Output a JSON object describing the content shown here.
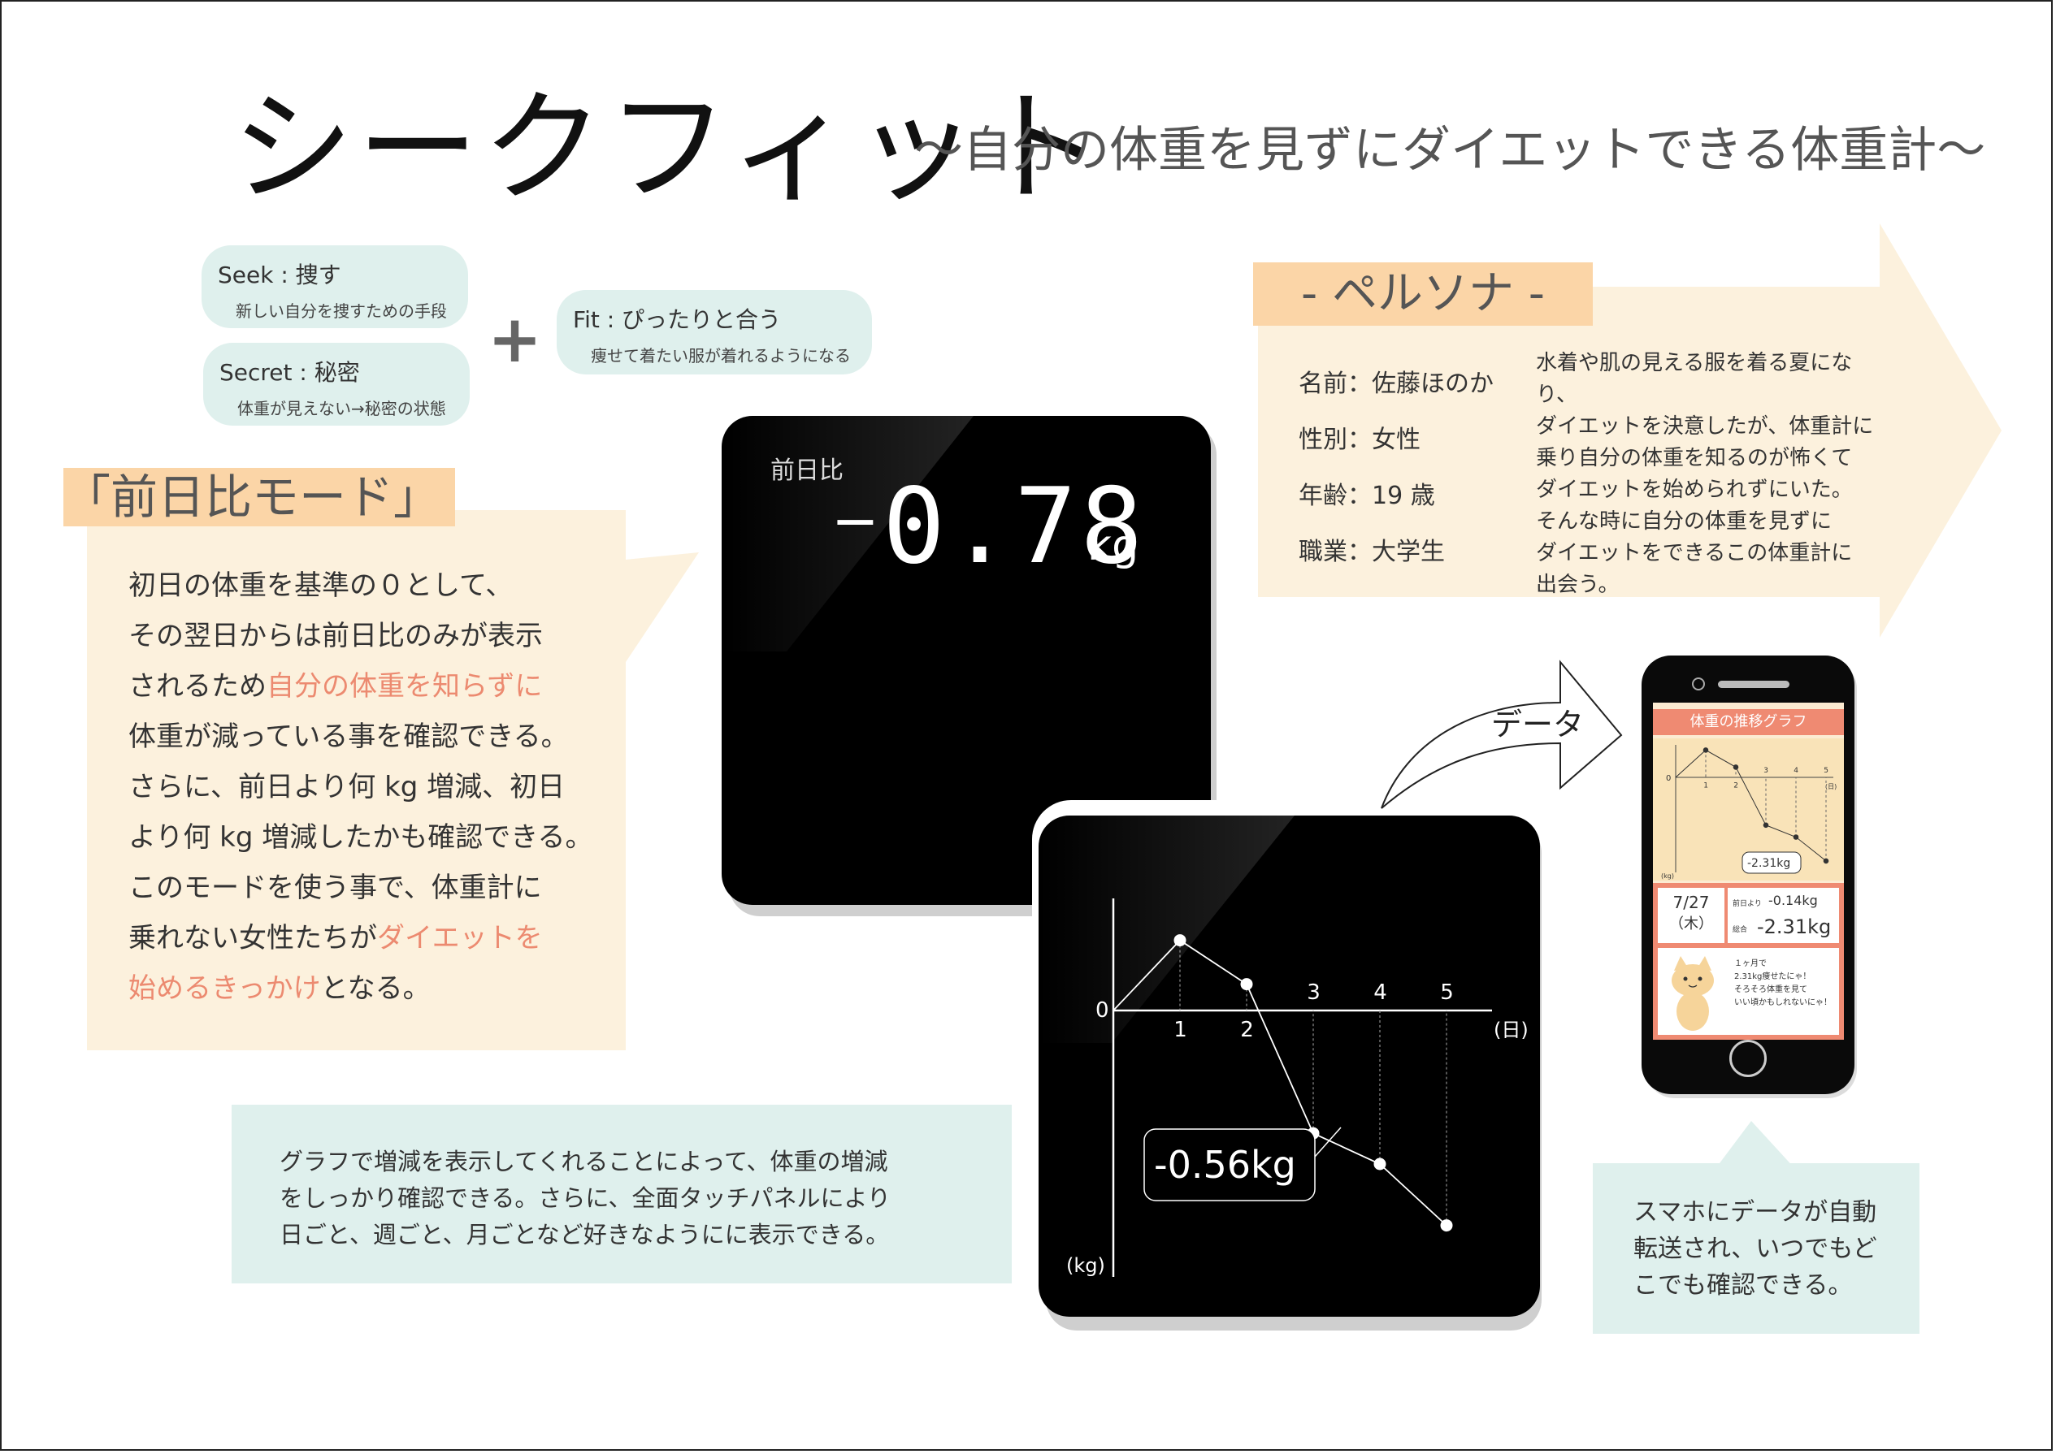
{
  "title": "シークフィット",
  "subtitle": "〜自分の体重を見ずにダイエットできる体重計〜",
  "concept": {
    "seek": {
      "head": "Seek : 捜す",
      "sub": "新しい自分を捜すための手段"
    },
    "secret": {
      "head": "Secret : 秘密",
      "sub": "体重が見えない→秘密の状態"
    },
    "plus": "+",
    "fit": {
      "head": "Fit : ぴったりと合う",
      "sub": "痩せて着たい服が着れるようになる"
    }
  },
  "mode": {
    "heading": "「前日比モード」",
    "l1": "初日の体重を基準の０として、",
    "l2": "その翌日からは前日比のみが表示",
    "l3a": "されるため",
    "l3b": "自分の体重を知らずに",
    "l4": "体重が減っている事を確認できる。",
    "l5": "さらに、前日より何 kg 増減、初日",
    "l6": "より何 kg 増減したかも確認できる。",
    "l7": "このモードを使う事で、体重計に",
    "l8a": "乗れない女性たちが",
    "l8b": "ダイエットを",
    "l9a": "始めるきっかけ",
    "l9b": "となる。"
  },
  "persona": {
    "heading": "- ペルソナ -",
    "name": "名前：佐藤ほのか",
    "gender": "性別：女性",
    "age": "年齢：19 歳",
    "job": "職業：大学生",
    "story": [
      "水着や肌の見える服を着る夏になり、",
      "ダイエットを決意したが、体重計に",
      "乗り自分の体重を知るのが怖くて",
      "ダイエットを始められずにいた。",
      "そんな時に自分の体重を見ずに",
      "ダイエットをできるこの体重計に",
      "出会う。"
    ]
  },
  "scale_display": {
    "label": "前日比",
    "sign": "−",
    "value": "0.78",
    "unit": "kg"
  },
  "transfer_arrow_label": "データ",
  "graph_scale": {
    "zero_label": "0",
    "x_unit": "(日)",
    "y_unit": "(kg)",
    "x_ticks": [
      "1",
      "2",
      "3",
      "4",
      "5"
    ],
    "callout": "-0.56kg"
  },
  "chart_data": {
    "type": "line",
    "x": [
      0,
      1,
      2,
      3,
      4,
      5
    ],
    "y": [
      0,
      0.32,
      0.12,
      -0.56,
      -0.7,
      -0.98
    ],
    "xlabel": "(日)",
    "ylabel": "(kg)",
    "annotation": "-0.56kg",
    "note": ""
  },
  "graph_explain": [
    "グラフで増減を表示してくれることによって、体重の増減",
    "をしっかり確認できる。さらに、全面タッチパネルにより",
    "日ごと、週ごと、月ごとなど好きなようにに表示できる。"
  ],
  "phone": {
    "header": "体重の推移グラフ",
    "zero": "0",
    "ticks": [
      "1",
      "2",
      "3",
      "4",
      "5"
    ],
    "x_unit": "(日)",
    "y_unit": "(kg)",
    "callout": "-2.31kg",
    "date": "7/27",
    "weekday": "（木）",
    "prev_label": "前日より",
    "prev_value": "-0.14kg",
    "total_label": "総合",
    "total_value": "-2.31kg",
    "message": [
      "１ヶ月で",
      "2.31kg痩せたにゃ！",
      "そろそろ体重を見て",
      "いい頃かもしれないにゃ！"
    ]
  },
  "phone_explain": [
    "スマホにデータが自動",
    "転送され、いつでもど",
    "こでも確認できる。"
  ],
  "colors": {
    "mint": "#dff0ed",
    "peach": "#fbd5a7",
    "cream": "#fcf1dd",
    "accent": "#ec8a70",
    "phone_red": "#ef8a72"
  }
}
